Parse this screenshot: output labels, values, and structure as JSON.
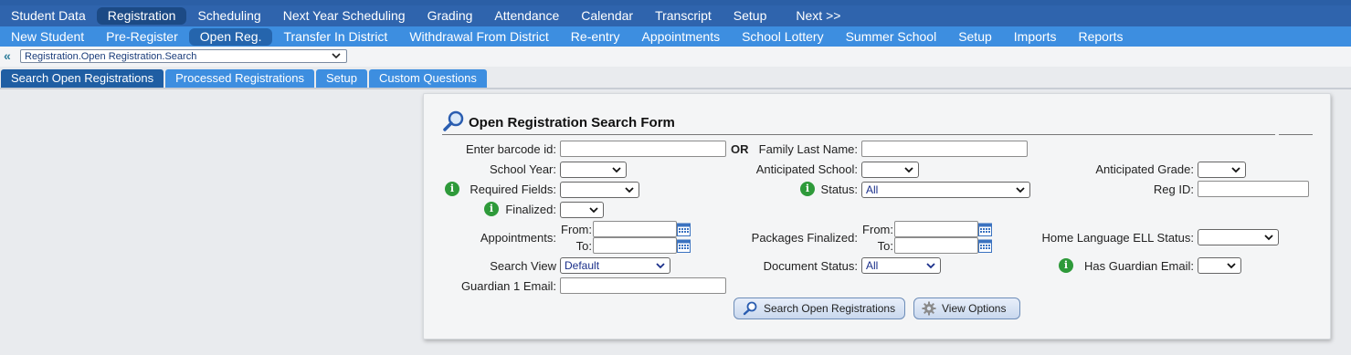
{
  "nav_main": [
    "Student Data",
    "Registration",
    "Scheduling",
    "Next Year Scheduling",
    "Grading",
    "Attendance",
    "Calendar",
    "Transcript",
    "Setup",
    "Next >>"
  ],
  "nav_sub": [
    "New Student",
    "Pre-Register",
    "Open Reg.",
    "Transfer In District",
    "Withdrawal From District",
    "Re-entry",
    "Appointments",
    "School Lottery",
    "Summer School",
    "Setup",
    "Imports",
    "Reports"
  ],
  "breadcrumb": {
    "back": "«",
    "value": "Registration.Open Registration.Search"
  },
  "tabs": [
    "Search Open Registrations",
    "Processed Registrations",
    "Setup",
    "Custom Questions"
  ],
  "form": {
    "title": "Open Registration Search Form",
    "barcode_label": "Enter barcode id:",
    "or_label": "OR",
    "last_name_label": "Family Last Name:",
    "school_year_label": "School Year:",
    "anticipated_school_label": "Anticipated School:",
    "anticipated_grade_label": "Anticipated Grade:",
    "required_fields_label": "Required Fields:",
    "status_label": "Status:",
    "status_value": "All",
    "reg_id_label": "Reg ID:",
    "finalized_label": "Finalized:",
    "appointments_label": "Appointments:",
    "packages_finalized_label": "Packages Finalized:",
    "from_label": "From:",
    "to_label": "To:",
    "home_language_label": "Home Language ELL Status:",
    "search_view_label": "Search View",
    "search_view_value": "Default",
    "document_status_label": "Document Status:",
    "document_status_value": "All",
    "has_guardian_email_label": "Has Guardian Email:",
    "guardian1_email_label": "Guardian 1 Email:",
    "search_button": "Search Open Registrations",
    "view_options_button": "View Options"
  },
  "colors": {
    "nav_main": "#2f64ad",
    "nav_sub": "#3d8ee0",
    "info": "#2e9a3a"
  }
}
